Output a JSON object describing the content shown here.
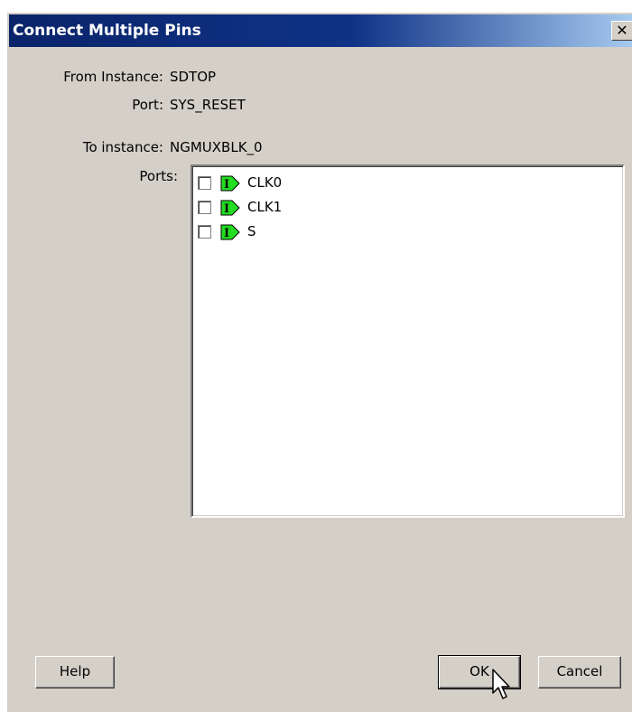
{
  "dialog": {
    "title": "Connect Multiple Pins",
    "close_glyph": "✕"
  },
  "from": {
    "instance_label": "From Instance:",
    "instance_value": "SDTOP",
    "port_label": "Port:",
    "port_value": "SYS_RESET"
  },
  "to": {
    "instance_label": "To instance:",
    "instance_value": "NGMUXBLK_0",
    "ports_label": "Ports:"
  },
  "ports": [
    {
      "name": "CLK0",
      "checked": false,
      "icon": "input-pin-icon"
    },
    {
      "name": "CLK1",
      "checked": false,
      "icon": "input-pin-icon"
    },
    {
      "name": "S",
      "checked": false,
      "icon": "input-pin-icon"
    }
  ],
  "buttons": {
    "help": "Help",
    "ok": "OK",
    "cancel": "Cancel"
  },
  "colors": {
    "titlebar_start": "#0a246a",
    "titlebar_end": "#a6caf0",
    "dialog_bg": "#d4d0c8",
    "pin_icon_fill": "#22dd22"
  }
}
